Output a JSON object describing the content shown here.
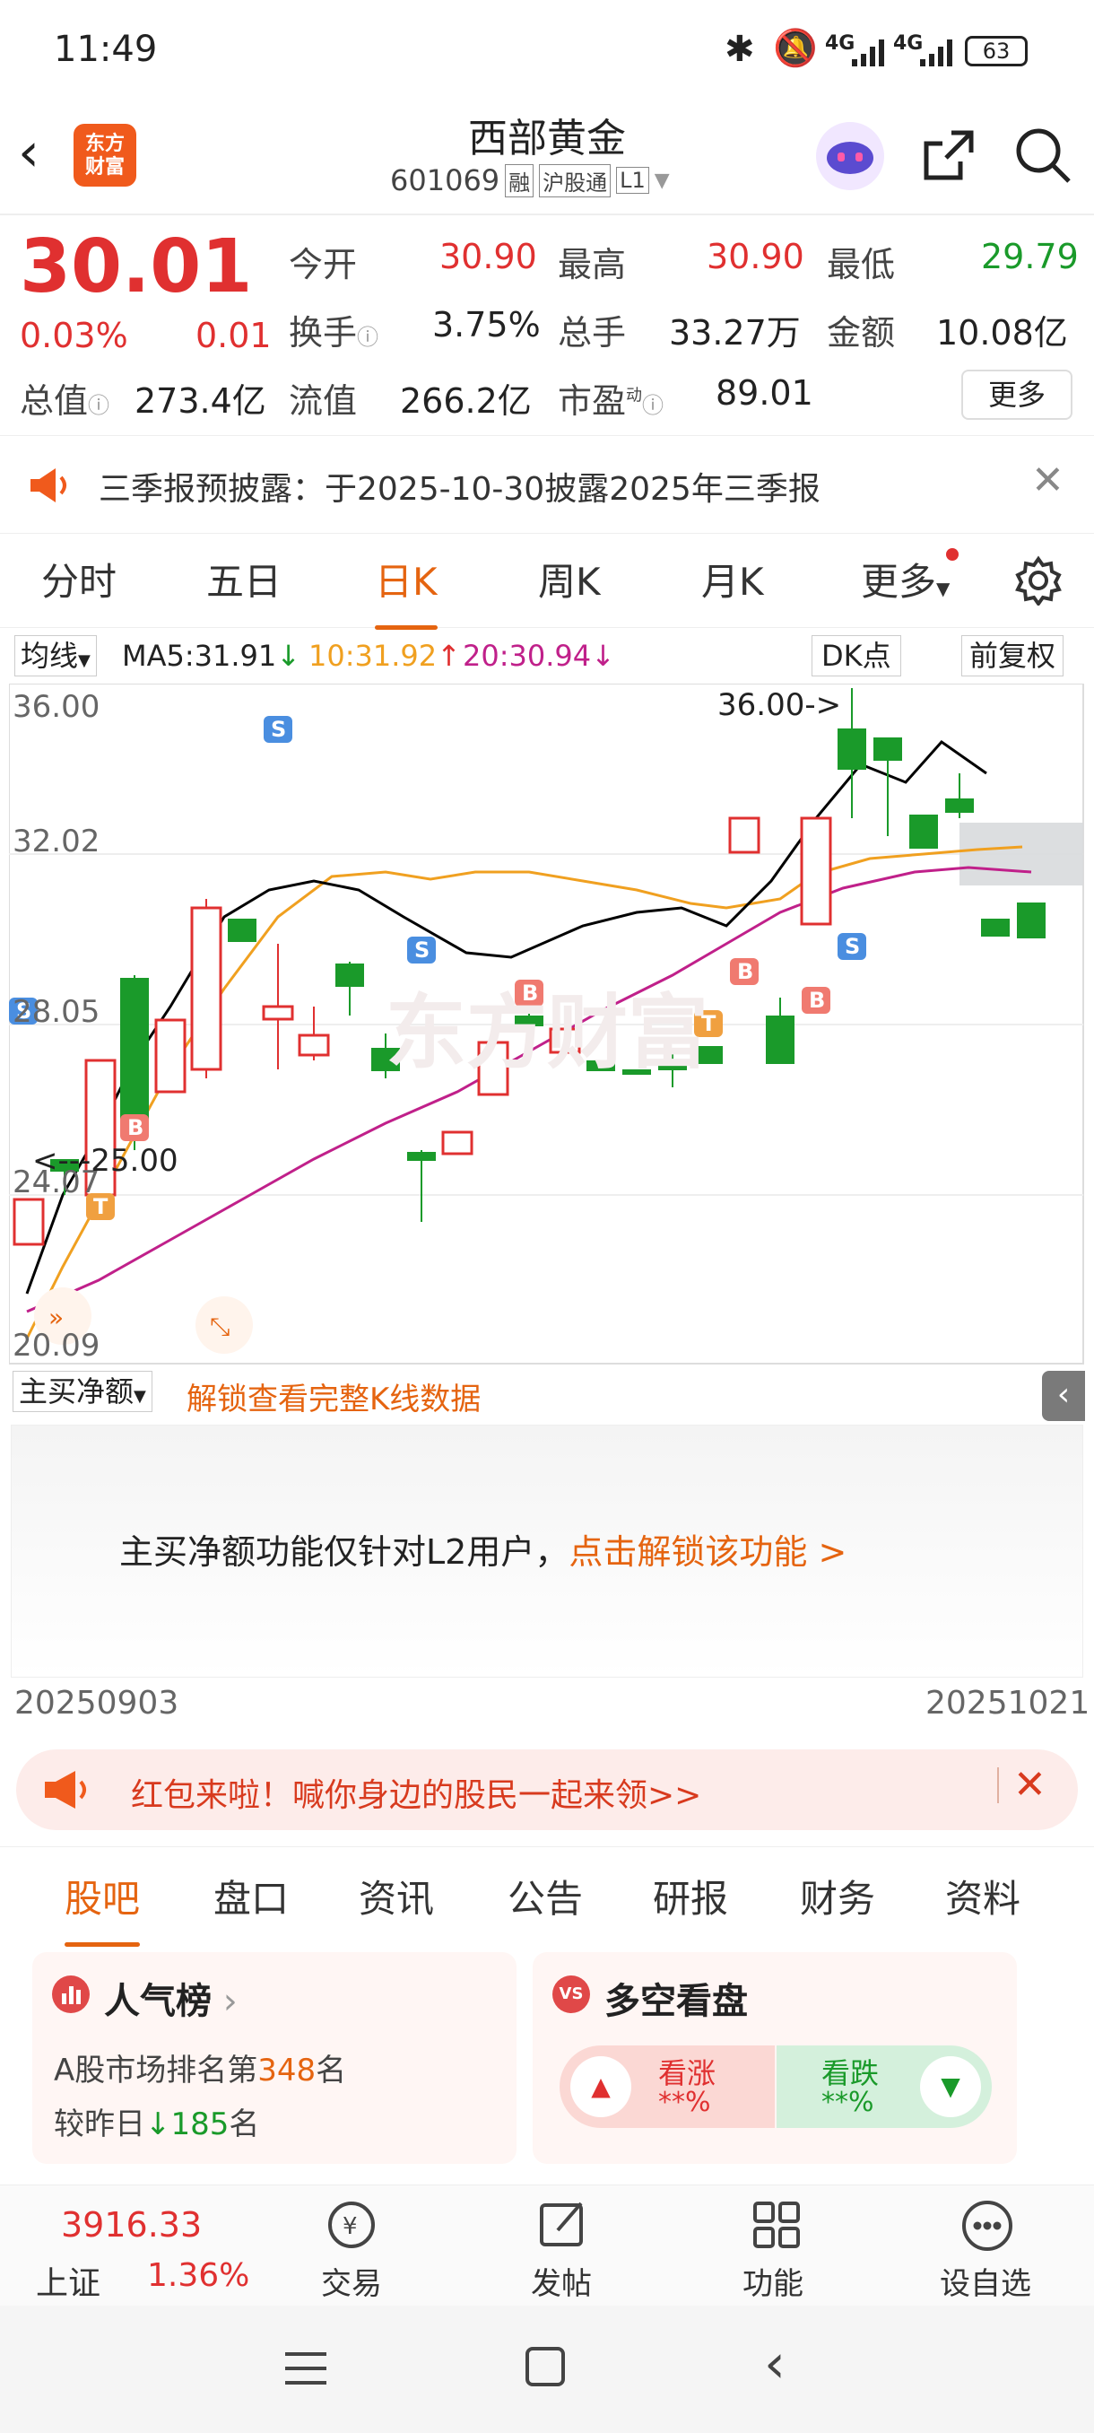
{
  "status": {
    "time": "11:49",
    "net1": "4G",
    "net2": "4G",
    "battery": "63"
  },
  "header": {
    "brand_line1": "东方",
    "brand_line2": "财富",
    "stock_name": "西部黄金",
    "stock_code": "601069",
    "tag_rong": "融",
    "tag_hgt": "沪股通",
    "tag_l1": "L1"
  },
  "quote": {
    "price": "30.01",
    "change_pct": "0.03%",
    "change": "0.01",
    "open_label": "今开",
    "open": "30.90",
    "high_label": "最高",
    "high": "30.90",
    "low_label": "最低",
    "low": "29.79",
    "turnover_label": "换手",
    "turnover": "3.75%",
    "volume_label": "总手",
    "volume": "33.27万",
    "amount_label": "金额",
    "amount": "10.08亿",
    "mktcap_label": "总值",
    "mktcap": "273.4亿",
    "float_label": "流值",
    "float": "266.2亿",
    "pe_label": "市盈",
    "pe_sup": "动",
    "pe": "89.01",
    "more": "更多"
  },
  "notice": {
    "text": "三季报预披露：于2025-10-30披露2025年三季报"
  },
  "tabs": {
    "t1": "分时",
    "t2": "五日",
    "t3": "日K",
    "t4": "周K",
    "t5": "月K",
    "t6": "更多"
  },
  "kline": {
    "ma_type": "均线",
    "ma5": "MA5:31.91",
    "ma10": "10:31.92",
    "ma20": "20:30.94",
    "dk_point": "DK点",
    "adjust": "前复权",
    "y_top": "36.00",
    "y_2": "32.02",
    "y_3": "28.05",
    "y_4": "24.07",
    "y_bottom": "20.09",
    "hi_label": "36.00->",
    "lo_label": "<---25.00",
    "watermark": "东方财富",
    "ind_name": "主买净额",
    "ind_unlock": "解锁查看完整K线数据",
    "ind_msg": "主买净额功能仅针对L2用户，",
    "ind_link": "点击解锁该功能 >",
    "date_start": "20250903",
    "date_end": "20251021"
  },
  "promo": {
    "text": "红包来啦！喊你身边的股民一起来领>>"
  },
  "section_tabs": {
    "s1": "股吧",
    "s2": "盘口",
    "s3": "资讯",
    "s4": "公告",
    "s5": "研报",
    "s6": "财务",
    "s7": "资料"
  },
  "cards": {
    "pop_title": "人气榜",
    "pop_line1a": "A股市场排名第",
    "pop_rank": "348",
    "pop_line1b": "名",
    "pop_line2a": "较昨日",
    "pop_delta": "185",
    "pop_line2b": "名",
    "vs_title": "多空看盘",
    "bull": "看涨",
    "bull_val": "**%",
    "bear": "看跌",
    "bear_val": "**%"
  },
  "bottom": {
    "index_val": "3916.33",
    "index_name": "上证",
    "index_pct": "1.36%",
    "trade": "交易",
    "post": "发帖",
    "func": "功能",
    "watch": "设自选"
  },
  "colors": {
    "up": "#e03030",
    "down": "#1a9a2a",
    "accent": "#e56410",
    "ma5": "#000000",
    "ma10": "#f0a020",
    "ma20": "#c0208a"
  }
}
